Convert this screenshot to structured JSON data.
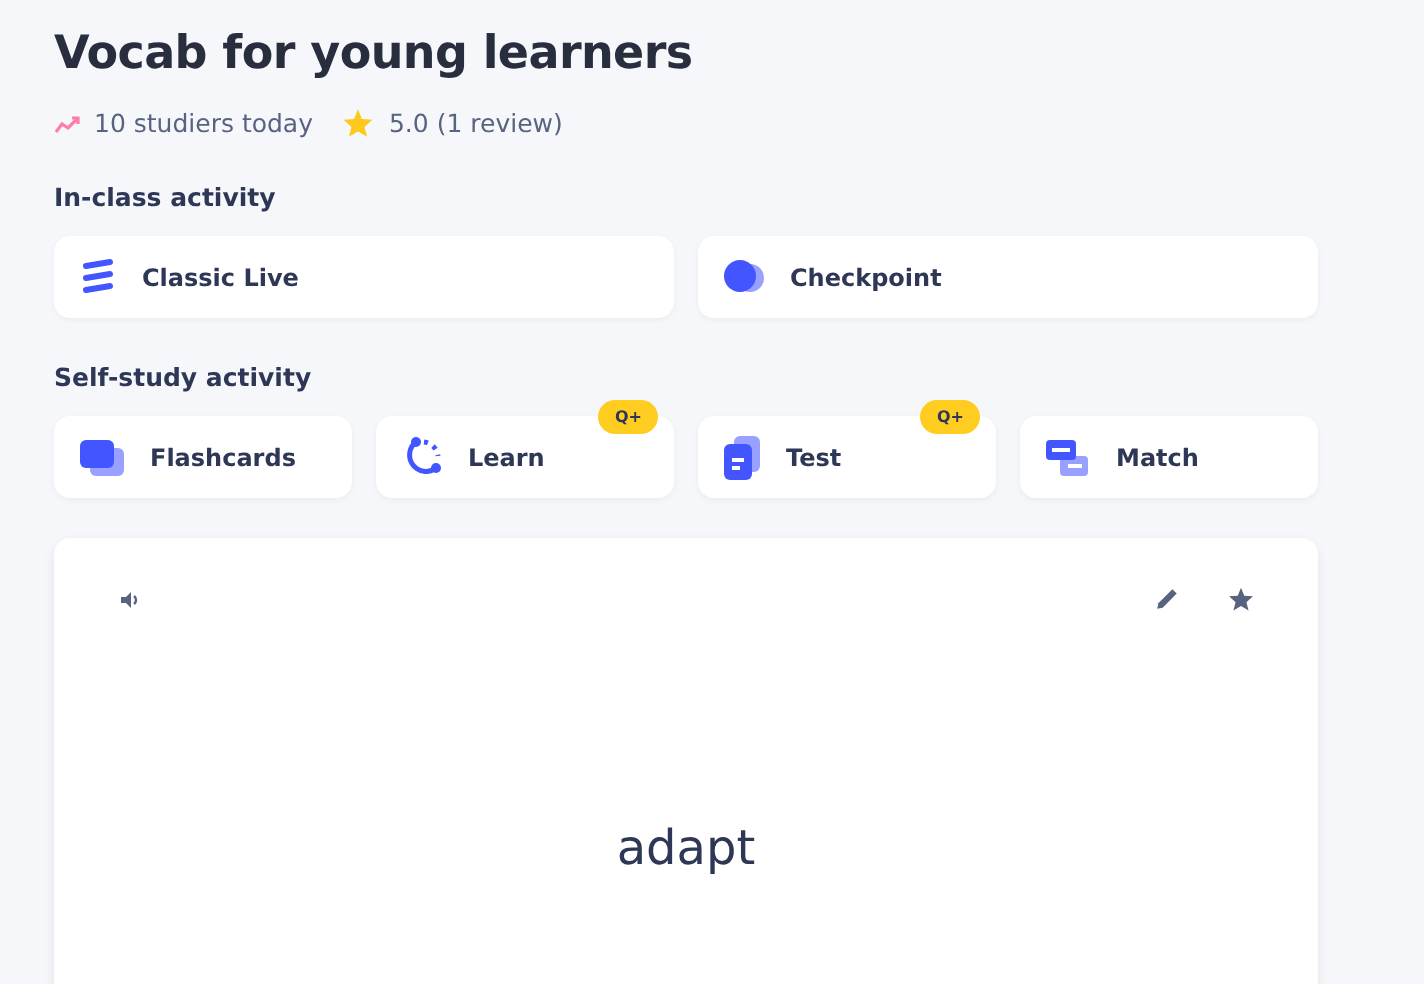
{
  "title": "Vocab for young learners",
  "stats": {
    "studiers": "10 studiers today",
    "rating": "5.0 (1 review)"
  },
  "sections": [
    {
      "heading": "In-class activity",
      "activities": [
        {
          "kind": "live",
          "label": "Classic Live"
        },
        {
          "kind": "checkpoint",
          "label": "Checkpoint"
        }
      ]
    },
    {
      "heading": "Self-study activity",
      "activities": [
        {
          "kind": "flashcards",
          "label": "Flashcards"
        },
        {
          "kind": "learn",
          "label": "Learn",
          "badge": "Q+"
        },
        {
          "kind": "test",
          "label": "Test",
          "badge": "Q+"
        },
        {
          "kind": "match",
          "label": "Match"
        }
      ]
    }
  ],
  "flashcard": {
    "term": "adapt"
  }
}
